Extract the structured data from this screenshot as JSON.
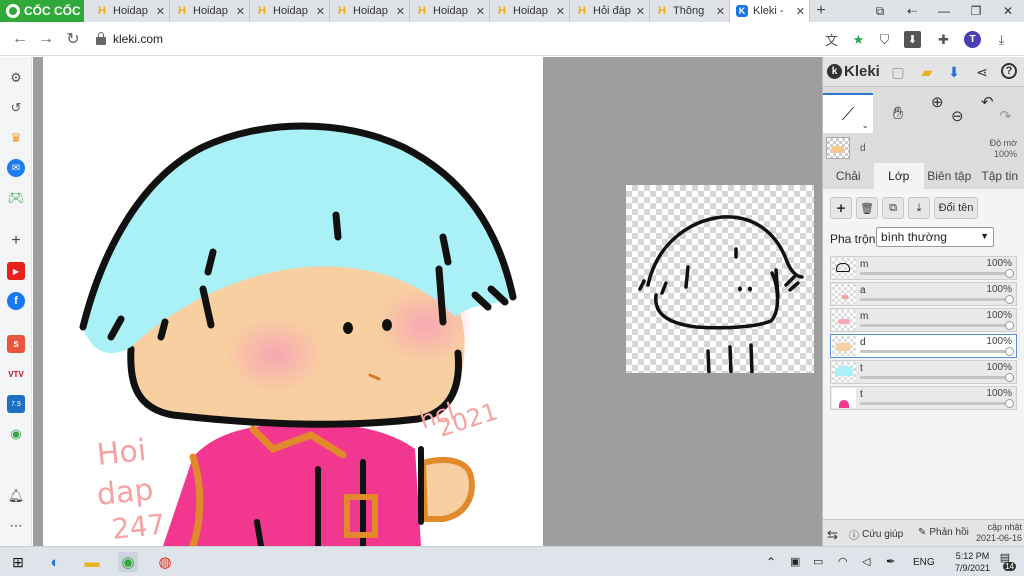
{
  "browser": {
    "brand": "CỐC CỐC",
    "tabs": [
      {
        "title": "Hoidap",
        "icon": "hoidap-favicon-icon"
      },
      {
        "title": "Hoidap",
        "icon": "hoidap-favicon-icon"
      },
      {
        "title": "Hoidap",
        "icon": "hoidap-favicon-icon"
      },
      {
        "title": "Hoidap",
        "icon": "hoidap-favicon-icon"
      },
      {
        "title": "Hoidap",
        "icon": "hoidap-favicon-icon"
      },
      {
        "title": "Hoidap",
        "icon": "hoidap-favicon-icon"
      },
      {
        "title": "Hỏi đáp",
        "icon": "hoidap-favicon-icon"
      },
      {
        "title": "Thông",
        "icon": "hoidap-favicon-icon"
      },
      {
        "title": "Kleki -",
        "icon": "kleki-favicon-icon",
        "active": true
      }
    ],
    "url": "kleki.com",
    "profile_initial": "T"
  },
  "kleki": {
    "logo": "Kleki",
    "active_layer_name": "d",
    "opacity_label": "Độ mờ",
    "opacity_value": "100%",
    "panel_tabs": [
      "Chải",
      "Lớp",
      "Biên tập",
      "Tập tin"
    ],
    "active_panel_tab": "Lớp",
    "rename_button": "Đổi tên",
    "blend_label": "Pha trộn",
    "blend_mode": "bình thường",
    "layers": [
      {
        "name": "m",
        "opacity": "100%"
      },
      {
        "name": "a",
        "opacity": "100%"
      },
      {
        "name": "m",
        "opacity": "100%"
      },
      {
        "name": "d",
        "opacity": "100%",
        "selected": true
      },
      {
        "name": "t",
        "opacity": "100%"
      },
      {
        "name": "t",
        "opacity": "100%"
      }
    ],
    "footer": {
      "help": "Cứu giúp",
      "feedback": "Phản hồi",
      "update_label": "cập nhật",
      "update_date": "2021-06-16"
    }
  },
  "drawing": {
    "signature_left": "Hoi dap 247",
    "signature_right": "hcl 2021"
  },
  "taskbar": {
    "language": "ENG",
    "time": "5:12 PM",
    "date": "7/9/2021",
    "notification_count": "14"
  },
  "colors": {
    "hair": "#a9f1f7",
    "skin": "#f8cfa0",
    "shirt": "#f2378e",
    "collar": "#e08a2b",
    "blush": "#f7a5b5",
    "signature": "#f6a3a3",
    "brand_green": "#31a83a",
    "accent_blue": "#2b7bd1"
  }
}
